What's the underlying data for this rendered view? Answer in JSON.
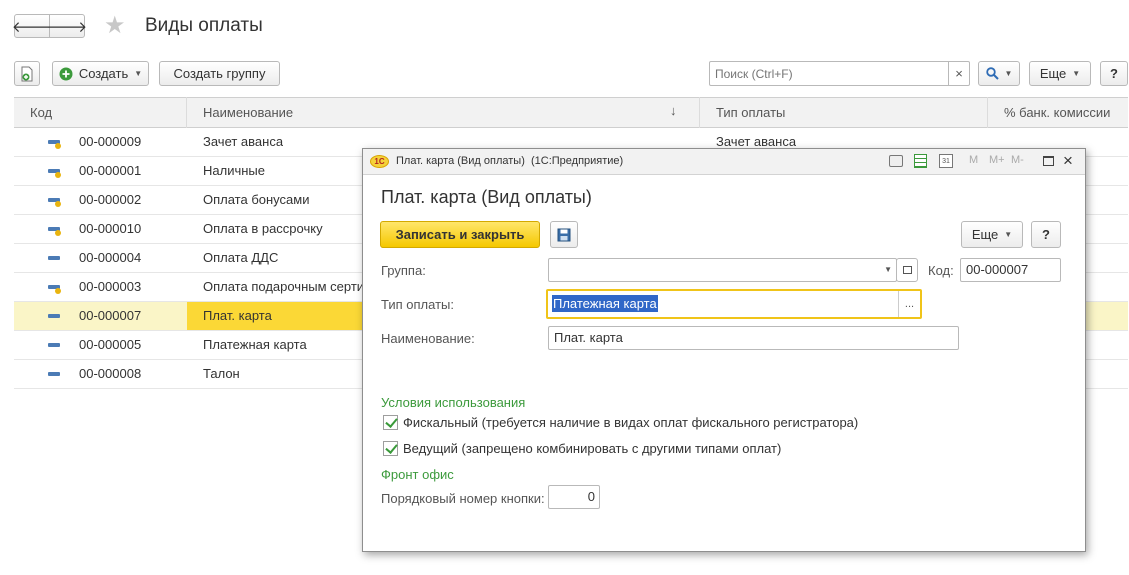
{
  "window": {
    "title": "Виды оплаты",
    "toolbar": {
      "create_label": "Создать",
      "create_group_label": "Создать группу",
      "search_placeholder": "Поиск (Ctrl+F)",
      "clear_label": "×",
      "more_label": "Еще",
      "help_label": "?"
    }
  },
  "table": {
    "columns": [
      "Код",
      "Наименование",
      "Тип оплаты",
      "% банк. комиссии"
    ],
    "sort_indicator": "↓",
    "rows": [
      {
        "code": "00-000009",
        "name": "Зачет аванса",
        "type": "Зачет аванса",
        "icon": "item-marked-icon"
      },
      {
        "code": "00-000001",
        "name": "Наличные",
        "type": "",
        "icon": "item-marked-icon"
      },
      {
        "code": "00-000002",
        "name": "Оплата бонусами",
        "type": "",
        "icon": "item-marked-icon"
      },
      {
        "code": "00-000010",
        "name": "Оплата в рассрочку",
        "type": "",
        "icon": "item-marked-icon"
      },
      {
        "code": "00-000004",
        "name": "Оплата ДДС",
        "type": "",
        "icon": "item-icon"
      },
      {
        "code": "00-000003",
        "name": "Оплата подарочным серти",
        "type": "",
        "icon": "item-marked-icon"
      },
      {
        "code": "00-000007",
        "name": "Плат. карта",
        "type": "",
        "icon": "item-icon",
        "selected": true
      },
      {
        "code": "00-000005",
        "name": "Платежная карта",
        "type": "",
        "icon": "item-icon"
      },
      {
        "code": "00-000008",
        "name": "Талон",
        "type": "",
        "icon": "item-icon"
      }
    ]
  },
  "dialog": {
    "titlebar": "Плат. карта (Вид оплаты)  (1С:Предприятие)",
    "app_logo": "1С",
    "title": "Плат. карта (Вид оплаты)",
    "save_close_label": "Записать и закрыть",
    "more_label": "Еще",
    "help_label": "?",
    "group_label": "Группа:",
    "group_value": "",
    "code_label": "Код:",
    "code_value": "00-000007",
    "payment_type_label": "Тип оплаты:",
    "payment_type_value": "Платежная карта",
    "ellipsis": "...",
    "name_label": "Наименование:",
    "name_value": "Плат. карта",
    "usage_section": "Условия использования",
    "fiscal_label": "Фискальный (требуется наличие в видах оплат фискального регистратора)",
    "fiscal_checked": true,
    "leading_label": "Ведущий (запрещено комбинировать с другими типами оплат)",
    "leading_checked": true,
    "front_office_section": "Фронт офис",
    "button_number_label": "Порядковый номер кнопки:",
    "button_number_value": "0",
    "titlebar_tools": [
      "M",
      "M+",
      "M-"
    ],
    "calendar_day": "31"
  },
  "colors": {
    "accent_yellow": "#fbd836",
    "selected_row": "#faf5c7",
    "section_green": "#3c9a3c",
    "focus_border": "#f0c419",
    "selection_blue": "#3067c8"
  }
}
